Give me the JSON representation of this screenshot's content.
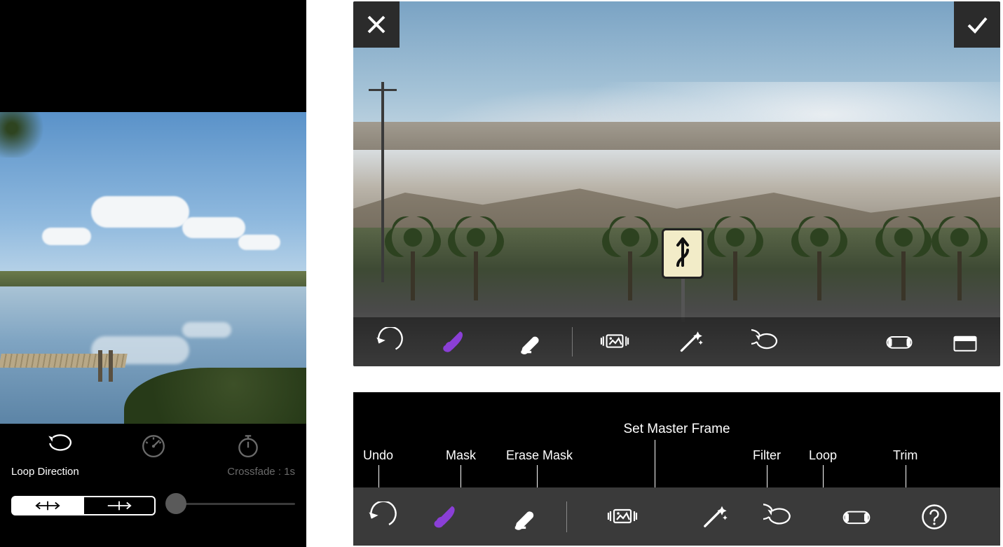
{
  "left": {
    "modes": [
      "loop",
      "speed",
      "timer"
    ],
    "loop_direction_label": "Loop Direction",
    "crossfade_label": "Crossfade : 1s",
    "toggle_options": [
      "back-and-forth",
      "forward"
    ],
    "toggle_selected": 0,
    "crossfade_value": 0
  },
  "editor": {
    "close": "Close",
    "confirm": "Confirm",
    "tools": [
      "undo",
      "mask",
      "erase-mask",
      "set-master-frame",
      "filter",
      "loop",
      "trim",
      "crop"
    ],
    "active_tool": "mask",
    "accent": "#8a3fd6"
  },
  "legend": {
    "title": "Set Master Frame",
    "items": [
      {
        "key": "undo",
        "label": "Undo"
      },
      {
        "key": "mask",
        "label": "Mask"
      },
      {
        "key": "erase-mask",
        "label": "Erase Mask"
      },
      {
        "key": "set-master-frame",
        "label": ""
      },
      {
        "key": "filter",
        "label": "Filter"
      },
      {
        "key": "loop",
        "label": "Loop"
      },
      {
        "key": "trim",
        "label": "Trim"
      },
      {
        "key": "help",
        "label": ""
      }
    ]
  }
}
